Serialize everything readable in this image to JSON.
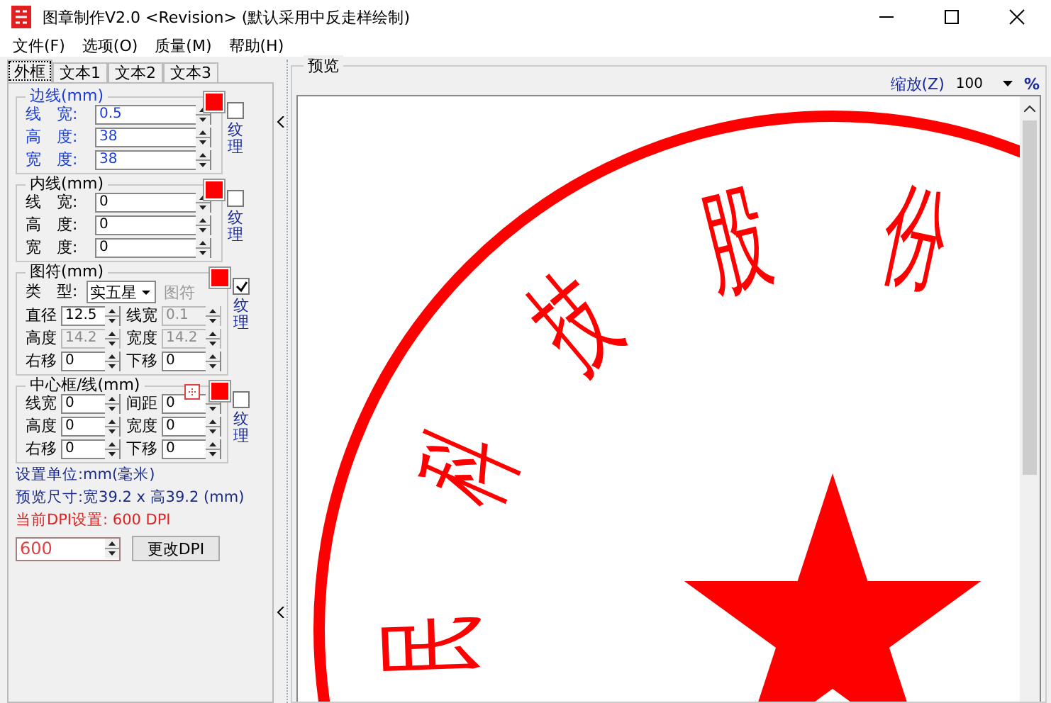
{
  "window": {
    "title": "图章制作V2.0  <Revision>  (默认采用中反走样绘制)"
  },
  "menu": [
    {
      "label": "文件(F)"
    },
    {
      "label": "选项(O)"
    },
    {
      "label": "质量(M)"
    },
    {
      "label": "帮助(H)"
    }
  ],
  "tabs": [
    {
      "label": "外框",
      "selected": true
    },
    {
      "label": "文本1",
      "selected": false
    },
    {
      "label": "文本2",
      "selected": false
    },
    {
      "label": "文本3",
      "selected": false
    }
  ],
  "groups": [
    {
      "title": "边线(mm)",
      "kind": "single",
      "active": true,
      "color": "#ff0000",
      "texture": {
        "label": "纹理",
        "checked": false
      },
      "fields": [
        {
          "label": "线　宽:",
          "value": "0.5",
          "disabled": false
        },
        {
          "label": "高　度:",
          "value": "38",
          "disabled": false
        },
        {
          "label": "宽　度:",
          "value": "38",
          "disabled": false
        }
      ]
    },
    {
      "title": "内线(mm)",
      "kind": "single",
      "active": false,
      "color": "#ff0000",
      "texture": {
        "label": "纹理",
        "checked": false
      },
      "fields": [
        {
          "label": "线　宽:",
          "value": "0",
          "disabled": false
        },
        {
          "label": "高　度:",
          "value": "0",
          "disabled": false
        },
        {
          "label": "宽　度:",
          "value": "0",
          "disabled": false
        }
      ]
    },
    {
      "title": "图符(mm)",
      "kind": "pair",
      "active": false,
      "color": "#ff0000",
      "symbol": {
        "label": "类　型:",
        "value": "实五星",
        "button": "图符"
      },
      "texture": {
        "label": "纹理",
        "checked": true
      },
      "fields": [
        {
          "label": "直径",
          "value": "12.5",
          "disabled": false
        },
        {
          "label": "线宽",
          "value": "0.1",
          "disabled": true
        },
        {
          "label": "高度",
          "value": "14.2",
          "disabled": true
        },
        {
          "label": "宽度",
          "value": "14.2",
          "disabled": true
        },
        {
          "label": "右移",
          "value": "0",
          "disabled": false
        },
        {
          "label": "下移",
          "value": "0",
          "disabled": false
        }
      ]
    },
    {
      "title": "中心框/线(mm)",
      "kind": "pair",
      "active": false,
      "color": "#ff0000",
      "frame_icon": true,
      "texture": {
        "label": "纹理",
        "checked": false
      },
      "fields": [
        {
          "label": "线宽",
          "value": "0",
          "disabled": false
        },
        {
          "label": "间距",
          "value": "0",
          "disabled": false
        },
        {
          "label": "高度",
          "value": "0",
          "disabled": false
        },
        {
          "label": "宽度",
          "value": "0",
          "disabled": false
        },
        {
          "label": "右移",
          "value": "0",
          "disabled": false
        },
        {
          "label": "下移",
          "value": "0",
          "disabled": false
        }
      ]
    }
  ],
  "info": {
    "unit": "设置单位:mm(毫米)",
    "size": "预览尺寸:宽39.2 x 高39.2 (mm)",
    "dpi_text": "当前DPI设置: 600 DPI",
    "dpi_value": "600",
    "dpi_button": "更改DPI"
  },
  "preview": {
    "title": "预览",
    "zoom_label": "缩放(Z)",
    "zoom_value": "100",
    "zoom_unit": "%",
    "seal": {
      "color": "#ff0000",
      "chars": [
        "民",
        "科",
        "技",
        "股",
        "份"
      ]
    }
  }
}
